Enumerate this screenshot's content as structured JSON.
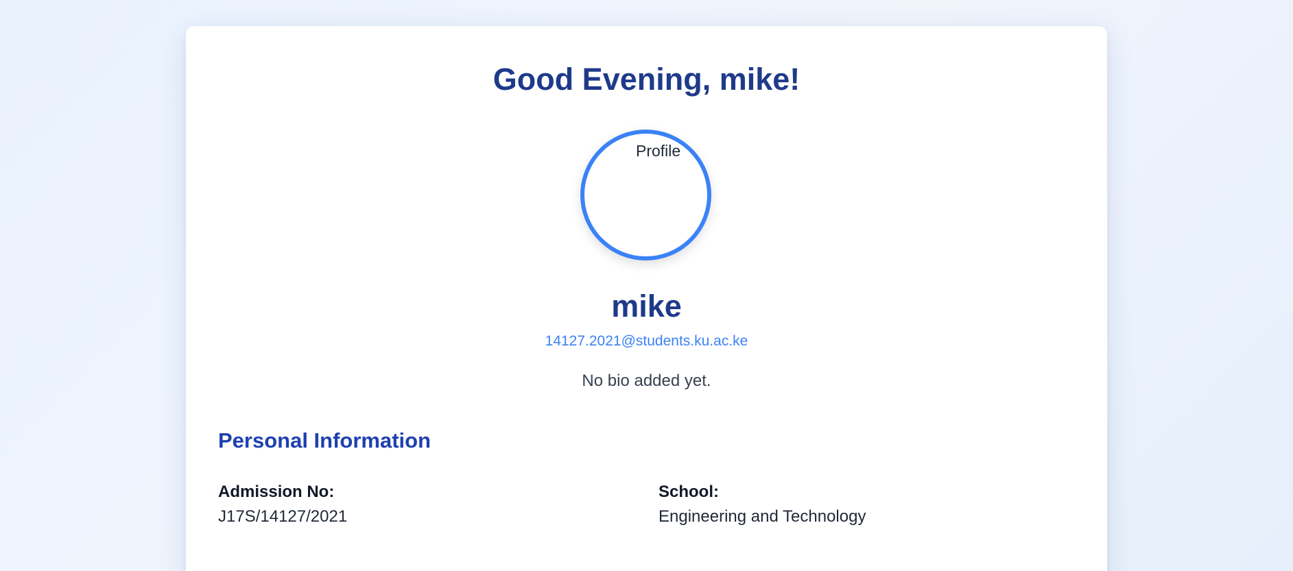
{
  "greeting": "Good Evening, mike!",
  "profile": {
    "avatar_alt": "Profile",
    "name": "mike",
    "email": "14127.2021@students.ku.ac.ke",
    "bio": "No bio added yet."
  },
  "personal_info": {
    "title": "Personal Information",
    "fields": [
      {
        "label": "Admission No:",
        "value": "J17S/14127/2021"
      },
      {
        "label": "School:",
        "value": "Engineering and Technology"
      }
    ]
  },
  "colors": {
    "primary": "#1e3a8a",
    "accent": "#3b82f6",
    "section": "#1e40af"
  }
}
